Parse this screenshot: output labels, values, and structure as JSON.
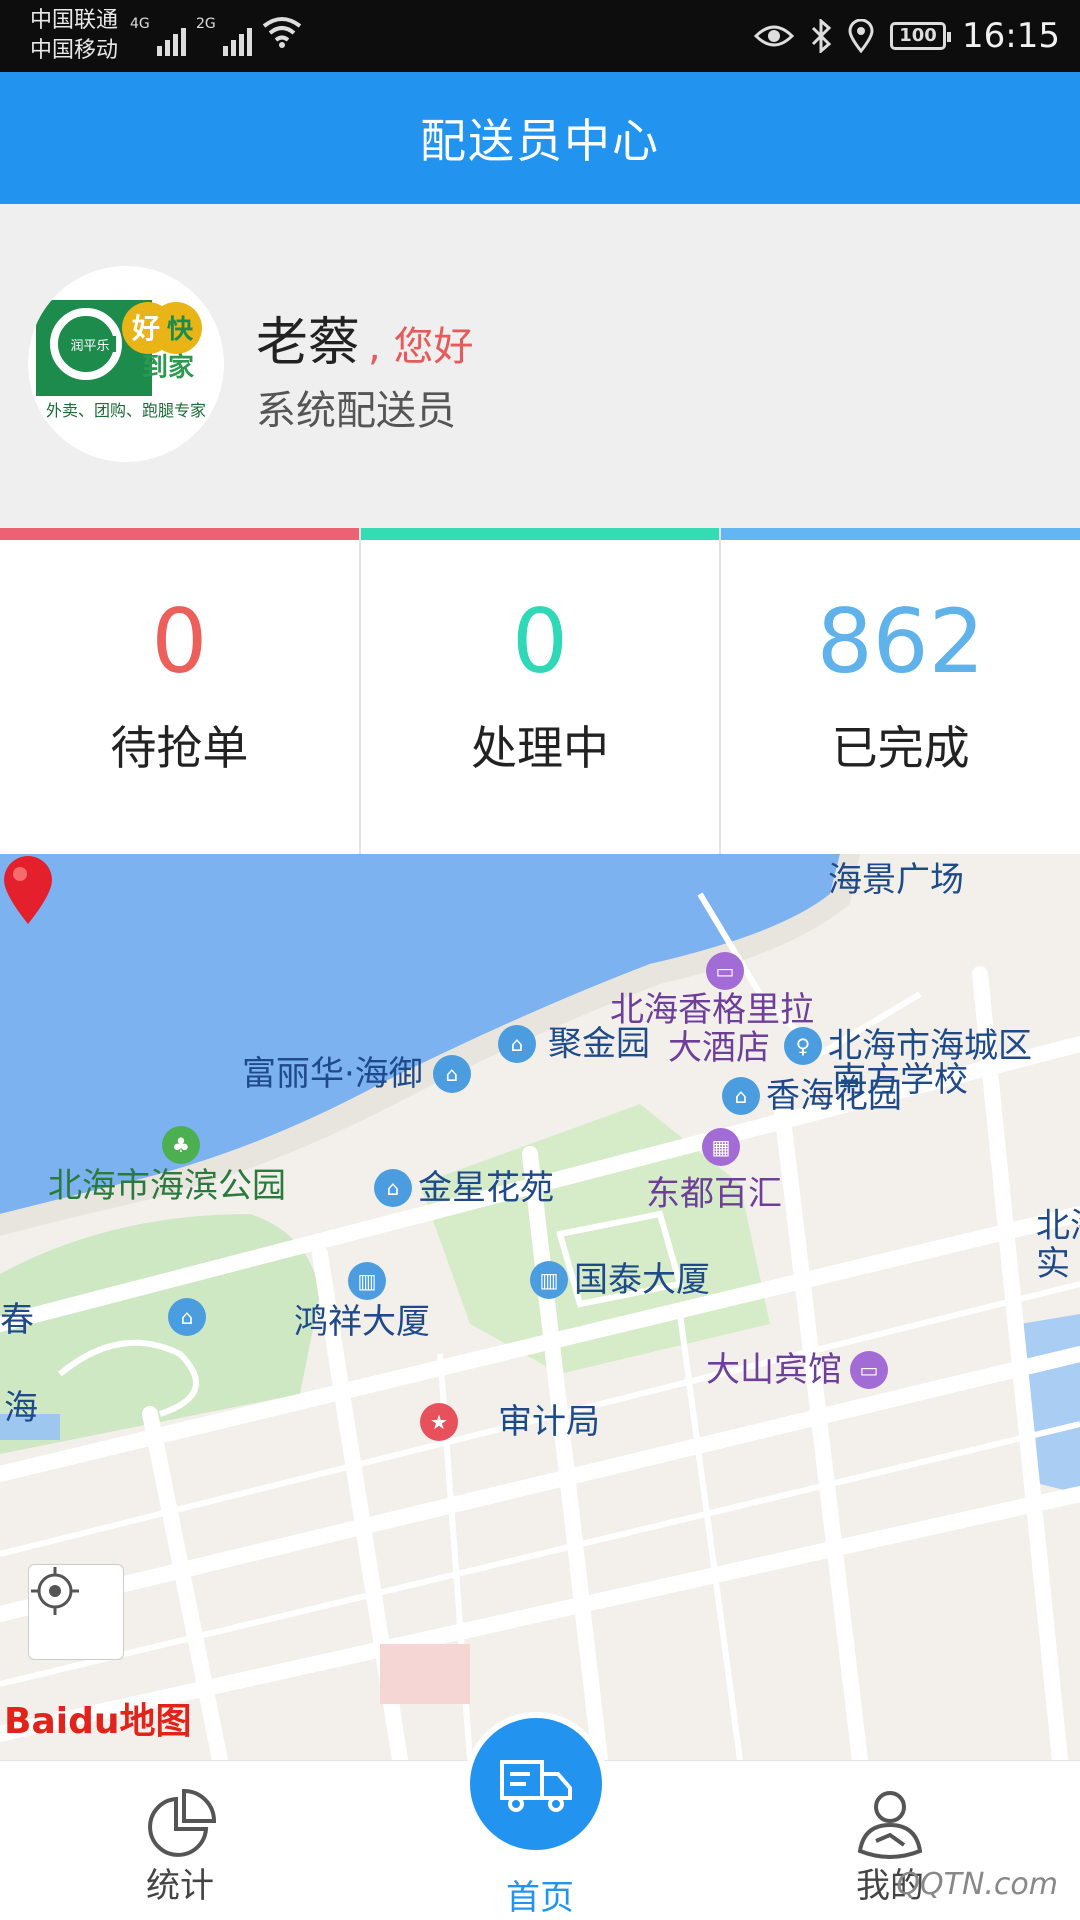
{
  "status_bar": {
    "carrier1": "中国联通",
    "carrier2": "中国移动",
    "net1": "4G",
    "net2": "2G",
    "battery": "100",
    "time": "16:15"
  },
  "header": {
    "title": "配送员中心"
  },
  "profile": {
    "name": "老蔡",
    "greeting": ", 您好",
    "role": "系统配送员",
    "logo": {
      "brand_small": "润平乐",
      "word1": "好",
      "word2": "快",
      "word3": "到家",
      "tagline": "外卖、团购、跑腿专家"
    }
  },
  "stats": [
    {
      "value": "0",
      "label": "待抢单",
      "color": "#ec5f5b",
      "bar": "#ec6173"
    },
    {
      "value": "0",
      "label": "处理中",
      "color": "#2fd8b6",
      "bar": "#34dcb4"
    },
    {
      "value": "862",
      "label": "已完成",
      "color": "#5fb2ea",
      "bar": "#62b7f2"
    }
  ],
  "map": {
    "provider": "Baidu地图",
    "pois": [
      {
        "name": "海景广场"
      },
      {
        "name": "北海香格里拉"
      },
      {
        "name": "大酒店"
      },
      {
        "name": "富丽华·海御"
      },
      {
        "name": "香海花园"
      },
      {
        "name": "聚金园"
      },
      {
        "name": "北海市海城区"
      },
      {
        "name": "南方学校"
      },
      {
        "name": "北海市海滨公园"
      },
      {
        "name": "金星花苑"
      },
      {
        "name": "东都百汇"
      },
      {
        "name": "国泰大厦"
      },
      {
        "name": "鸿祥大厦"
      },
      {
        "name": "大山宾馆"
      },
      {
        "name": "审计局"
      },
      {
        "name": "北海"
      },
      {
        "name": "实"
      },
      {
        "name": "春"
      },
      {
        "name": "海"
      }
    ]
  },
  "nav": {
    "stats": "统计",
    "home": "首页",
    "mine": "我的"
  },
  "watermark": "QQTN.com"
}
